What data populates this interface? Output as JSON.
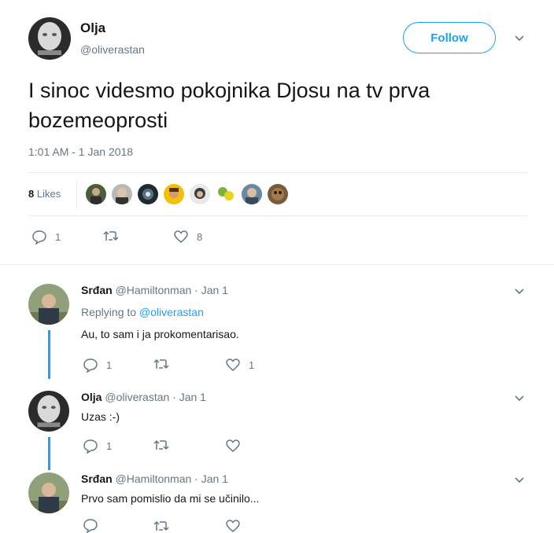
{
  "main_tweet": {
    "author_name": "Olja",
    "author_handle": "@oliverastan",
    "follow_label": "Follow",
    "text": "I sinoc videsmo pokojnika Djosu  na tv prva bozemeoprosti",
    "timestamp": "1:01 AM - 1 Jan 2018",
    "likes_count": "8",
    "likes_word": "Likes",
    "actions": {
      "replies": "1",
      "retweets": "",
      "likes": "8"
    }
  },
  "replies": [
    {
      "name": "Srđan",
      "handle": "@Hamiltonman",
      "date": "· Jan 1",
      "replying_prefix": "Replying to",
      "replying_handle": "@oliverastan",
      "text": "Au, to sam i ja prokomentarisao.",
      "actions": {
        "replies": "1",
        "retweets": "",
        "likes": "1"
      }
    },
    {
      "name": "Olja",
      "handle": "@oliverastan",
      "date": "· Jan 1",
      "text": "Uzas :-)",
      "actions": {
        "replies": "1",
        "retweets": "",
        "likes": ""
      }
    },
    {
      "name": "Srđan",
      "handle": "@Hamiltonman",
      "date": "· Jan 1",
      "text": "Prvo sam pomislio da mi se učinilo..."
    }
  ],
  "colors": {
    "accent": "#1da1f2",
    "muted": "#657786",
    "text": "#14171a",
    "divider": "#e6ecf0"
  },
  "icons": [
    "reply-icon",
    "retweet-icon",
    "heart-icon",
    "chevron-down-icon"
  ]
}
